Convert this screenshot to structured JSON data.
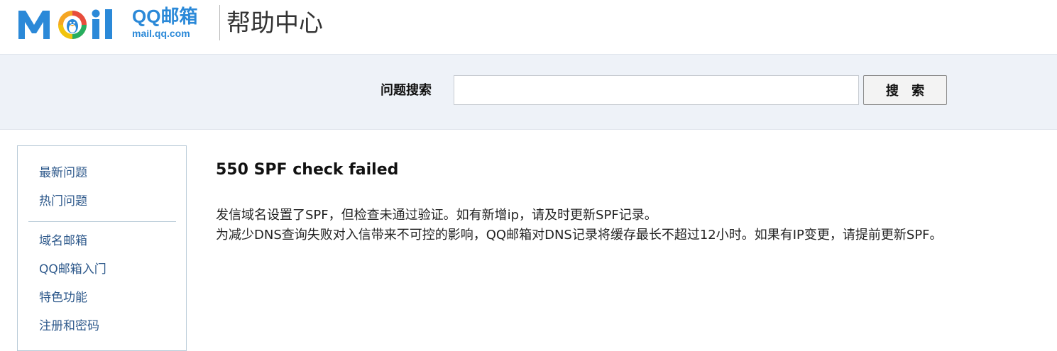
{
  "header": {
    "logo_word": "Mail",
    "logo_qq_title": "QQ邮箱",
    "logo_qq_domain": "mail.qq.com",
    "help_title": "帮助中心"
  },
  "search": {
    "label": "问题搜索",
    "input_value": "",
    "button_label": "搜 索"
  },
  "sidebar": {
    "group1": [
      "最新问题",
      "热门问题"
    ],
    "group2": [
      "域名邮箱",
      "QQ邮箱入门",
      "特色功能",
      "注册和密码"
    ]
  },
  "article": {
    "title": "550 SPF check failed",
    "paragraphs": [
      "发信域名设置了SPF，但检查未通过验证。如有新增ip，请及时更新SPF记录。",
      "为减少DNS查询失败对入信带来不可控的影响，QQ邮箱对DNS记录将缓存最长不超过12小时。如果有IP变更，请提前更新SPF。"
    ]
  },
  "colors": {
    "brand_blue": "#2b89d8",
    "search_band_bg": "#eef2f8",
    "link_color": "#2f5a8c"
  },
  "icons": {
    "logo": "qq-penguin-logo-icon"
  }
}
